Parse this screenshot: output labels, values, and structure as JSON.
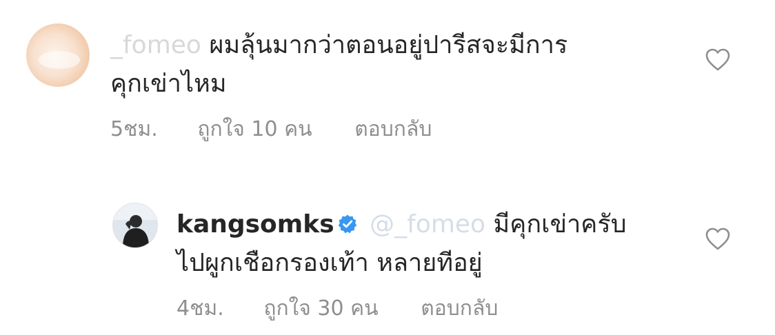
{
  "comments": [
    {
      "username": "_fomeo",
      "text_line1": "ผมลุ้นมากว่าตอนอยู่ปารีสจะมีการ",
      "text_line2": "คุกเข่าไหม",
      "time": "5ชม.",
      "likes": "ถูกใจ 10 คน",
      "reply": "ตอบกลับ"
    },
    {
      "username": "kangsomks",
      "mention": "@_fomeo",
      "text_line1": "มีคุกเข่าครับ",
      "text_line2": "ไปผูกเชือกรองเท้า หลายทีอยู่",
      "time": "4ชม.",
      "likes": "ถูกใจ 30 คน",
      "reply": "ตอบกลับ"
    }
  ],
  "colors": {
    "text": "#262626",
    "meta": "#8e8e8e",
    "verified": "#3897f0",
    "heart_outline": "#8e8e8e"
  }
}
